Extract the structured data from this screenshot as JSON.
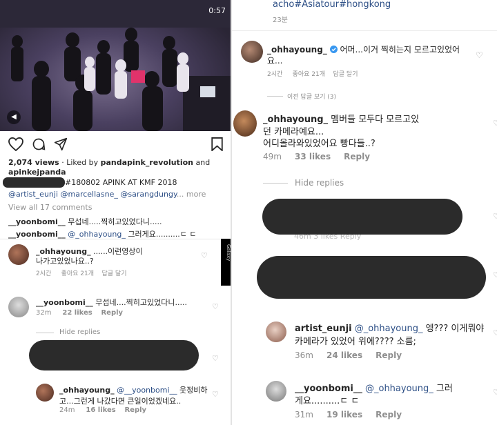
{
  "post": {
    "video_time": "0:57",
    "views_line": "2,074 views",
    "liked_by_prefix": " · Liked by ",
    "liked_by_user1": "pandapink_revolution",
    "liked_by_and": " and",
    "liked_by_user2": "apinkejpanda",
    "caption": "#180802 APINK AT KMF 2018",
    "mentions": "@artist_eunji @marcellasne_ @sarangdungy",
    "more": "... more",
    "view_all": "View all 17 comments",
    "inline_comments": [
      {
        "user": "__yoonbomi__",
        "text": " 무섭네.....찍히고있었다니....."
      },
      {
        "user": "__yoonbomi__",
        "mention": " @_ohhayoung_",
        "text": " 그러게요..........ㄷ ㄷ"
      }
    ]
  },
  "left_thread": {
    "c1": {
      "user": "_ohhayoung_",
      "line1": "......이런영상이",
      "line2": "나가고있었나요..?",
      "time": "2시간",
      "likes": "좋아요 21개",
      "reply": "답글 달기"
    },
    "c2": {
      "user": "__yoonbomi__",
      "text": "무섭네....찍히고있었다니.....",
      "time": "32m",
      "likes": "22 likes",
      "reply": "Reply"
    },
    "hide": "Hide replies",
    "c3": {
      "user": "_ohhayoung_",
      "mention": "@__yoonbomi__",
      "line1_rest": " 웃정비하",
      "line2": "고...그런게 나갔다면 큰일이었겠네요..",
      "time": "24m",
      "likes": "16 likes",
      "reply": "Reply"
    },
    "side_label": "Galaxy"
  },
  "right_thread": {
    "top_tags": "acho#Asiatour#hongkong",
    "top_time": "23분",
    "r1": {
      "user": "_ohhayoung_",
      "line1": "어머...이거 찍히는지 모르고있었어",
      "line2": "요...",
      "time": "2시간",
      "likes": "좋아요 21개",
      "reply": "답글 달기"
    },
    "prev_replies": "이전 답글 보기 (3)",
    "r2": {
      "user": "_ohhayoung_",
      "line1_rest": " 멤버들 모두다 모르고있",
      "line2": "던 카메라예요...",
      "line3": "어디올라와있었어요 빵다들..?",
      "time": "49m",
      "likes": "33 likes",
      "reply": "Reply"
    },
    "hide": "Hide replies",
    "redact1_meta": "46m     3 likes      Reply",
    "r3": {
      "user": "artist_eunji",
      "mention": "@_ohhayoung_",
      "line1_rest": " 엥??? 이게뭐야",
      "line2": "카메라가 있었어 위에???? 소름;",
      "time": "36m",
      "likes": "24 likes",
      "reply": "Reply"
    },
    "r4": {
      "user": "__yoonbomi__",
      "mention": "@_ohhayoung_",
      "line1_rest": " 그러",
      "line2": "게요..........ㄷ ㄷ",
      "time": "31m",
      "likes": "19 likes",
      "reply": "Reply"
    }
  },
  "icons": [
    "heart-icon",
    "comment-icon",
    "share-icon",
    "bookmark-icon",
    "mute-icon",
    "verified-badge-icon"
  ],
  "colors": {
    "link": "#2d4f86",
    "meta": "#8e8e8e",
    "verified": "#3897f0",
    "redaction": "#2b2b2b"
  }
}
